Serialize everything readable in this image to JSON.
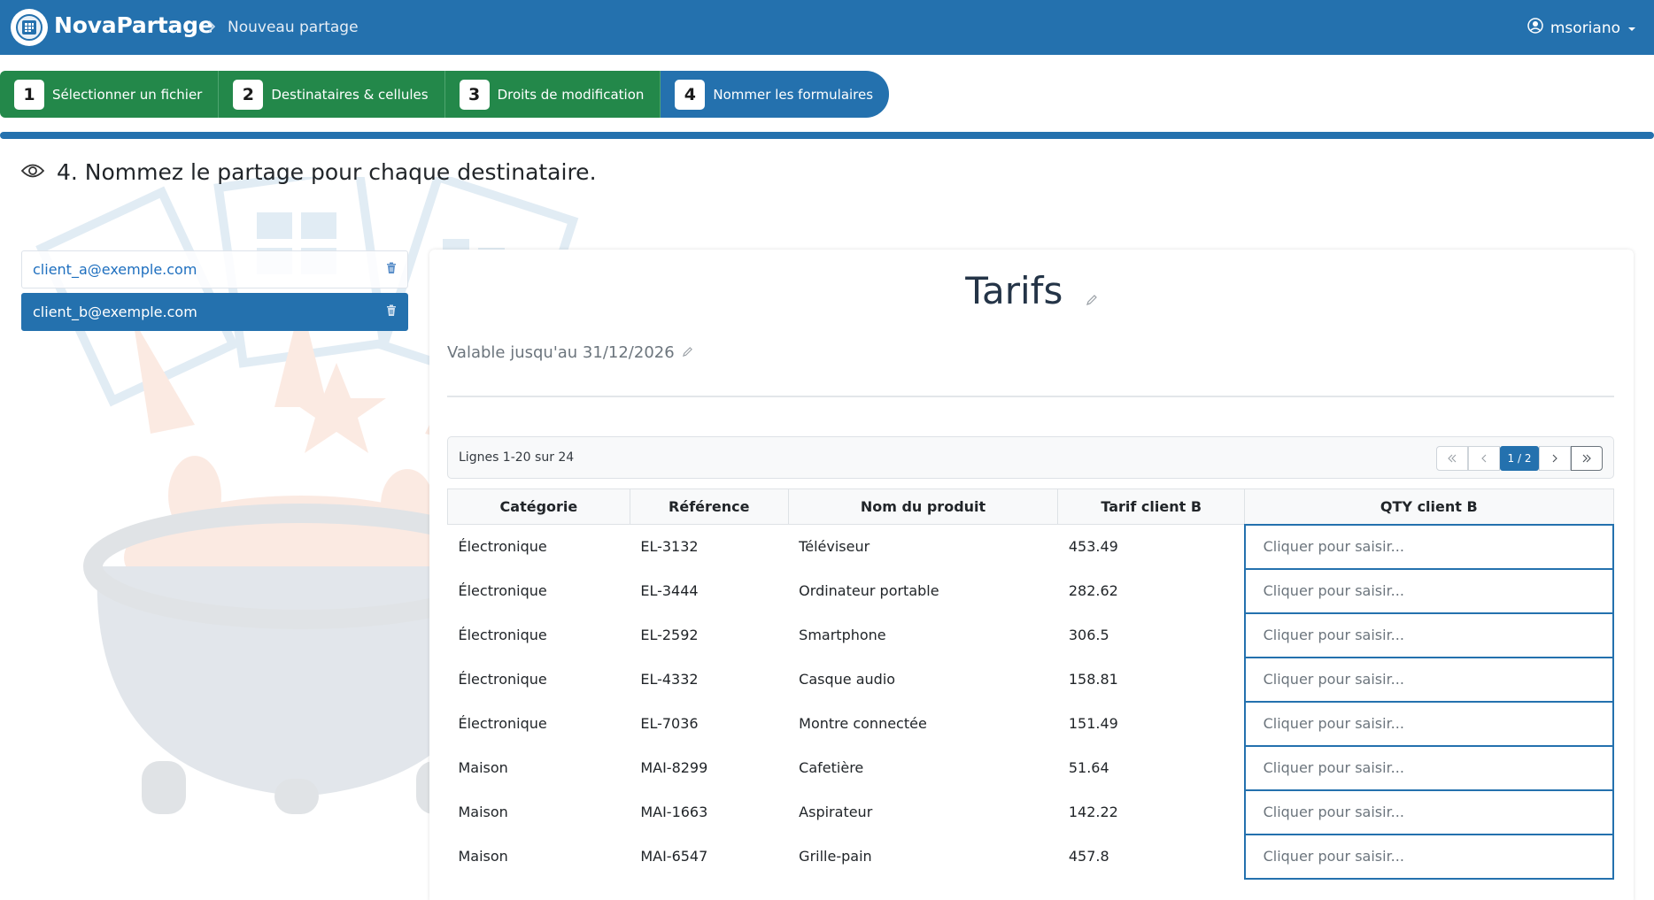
{
  "navbar": {
    "brand": "NovaPartage",
    "breadcrumb": "Nouveau partage",
    "username": "msoriano"
  },
  "steps": [
    {
      "num": "1",
      "label": "Sélectionner un fichier"
    },
    {
      "num": "2",
      "label": "Destinataires & cellules"
    },
    {
      "num": "3",
      "label": "Droits de modification"
    },
    {
      "num": "4",
      "label": "Nommer les formulaires"
    }
  ],
  "heading": "4. Nommez le partage pour chaque destinataire.",
  "recipients": [
    {
      "email": "client_a@exemple.com"
    },
    {
      "email": "client_b@exemple.com"
    }
  ],
  "form": {
    "title": "Tarifs",
    "validity": "Valable jusqu'au 31/12/2026"
  },
  "table": {
    "rows_info": "Lignes 1-20 sur 24",
    "page": "1 / 2",
    "headers": [
      "Catégorie",
      "Référence",
      "Nom du produit",
      "Tarif client B",
      "QTY client B"
    ],
    "qty_placeholder": "Cliquer pour saisir...",
    "rows": [
      [
        "Électronique",
        "EL-3132",
        "Téléviseur",
        "453.49"
      ],
      [
        "Électronique",
        "EL-3444",
        "Ordinateur portable",
        "282.62"
      ],
      [
        "Électronique",
        "EL-2592",
        "Smartphone",
        "306.5"
      ],
      [
        "Électronique",
        "EL-4332",
        "Casque audio",
        "158.81"
      ],
      [
        "Électronique",
        "EL-7036",
        "Montre connectée",
        "151.49"
      ],
      [
        "Maison",
        "MAI-8299",
        "Cafetière",
        "51.64"
      ],
      [
        "Maison",
        "MAI-1663",
        "Aspirateur",
        "142.22"
      ],
      [
        "Maison",
        "MAI-6547",
        "Grille-pain",
        "457.8"
      ]
    ]
  },
  "colors": {
    "primary": "#2471ae",
    "success": "#23884a"
  },
  "icons": {
    "user": "user-circle-icon",
    "trash": "trash-icon",
    "edit": "pencil-icon",
    "view": "eye-icon"
  }
}
